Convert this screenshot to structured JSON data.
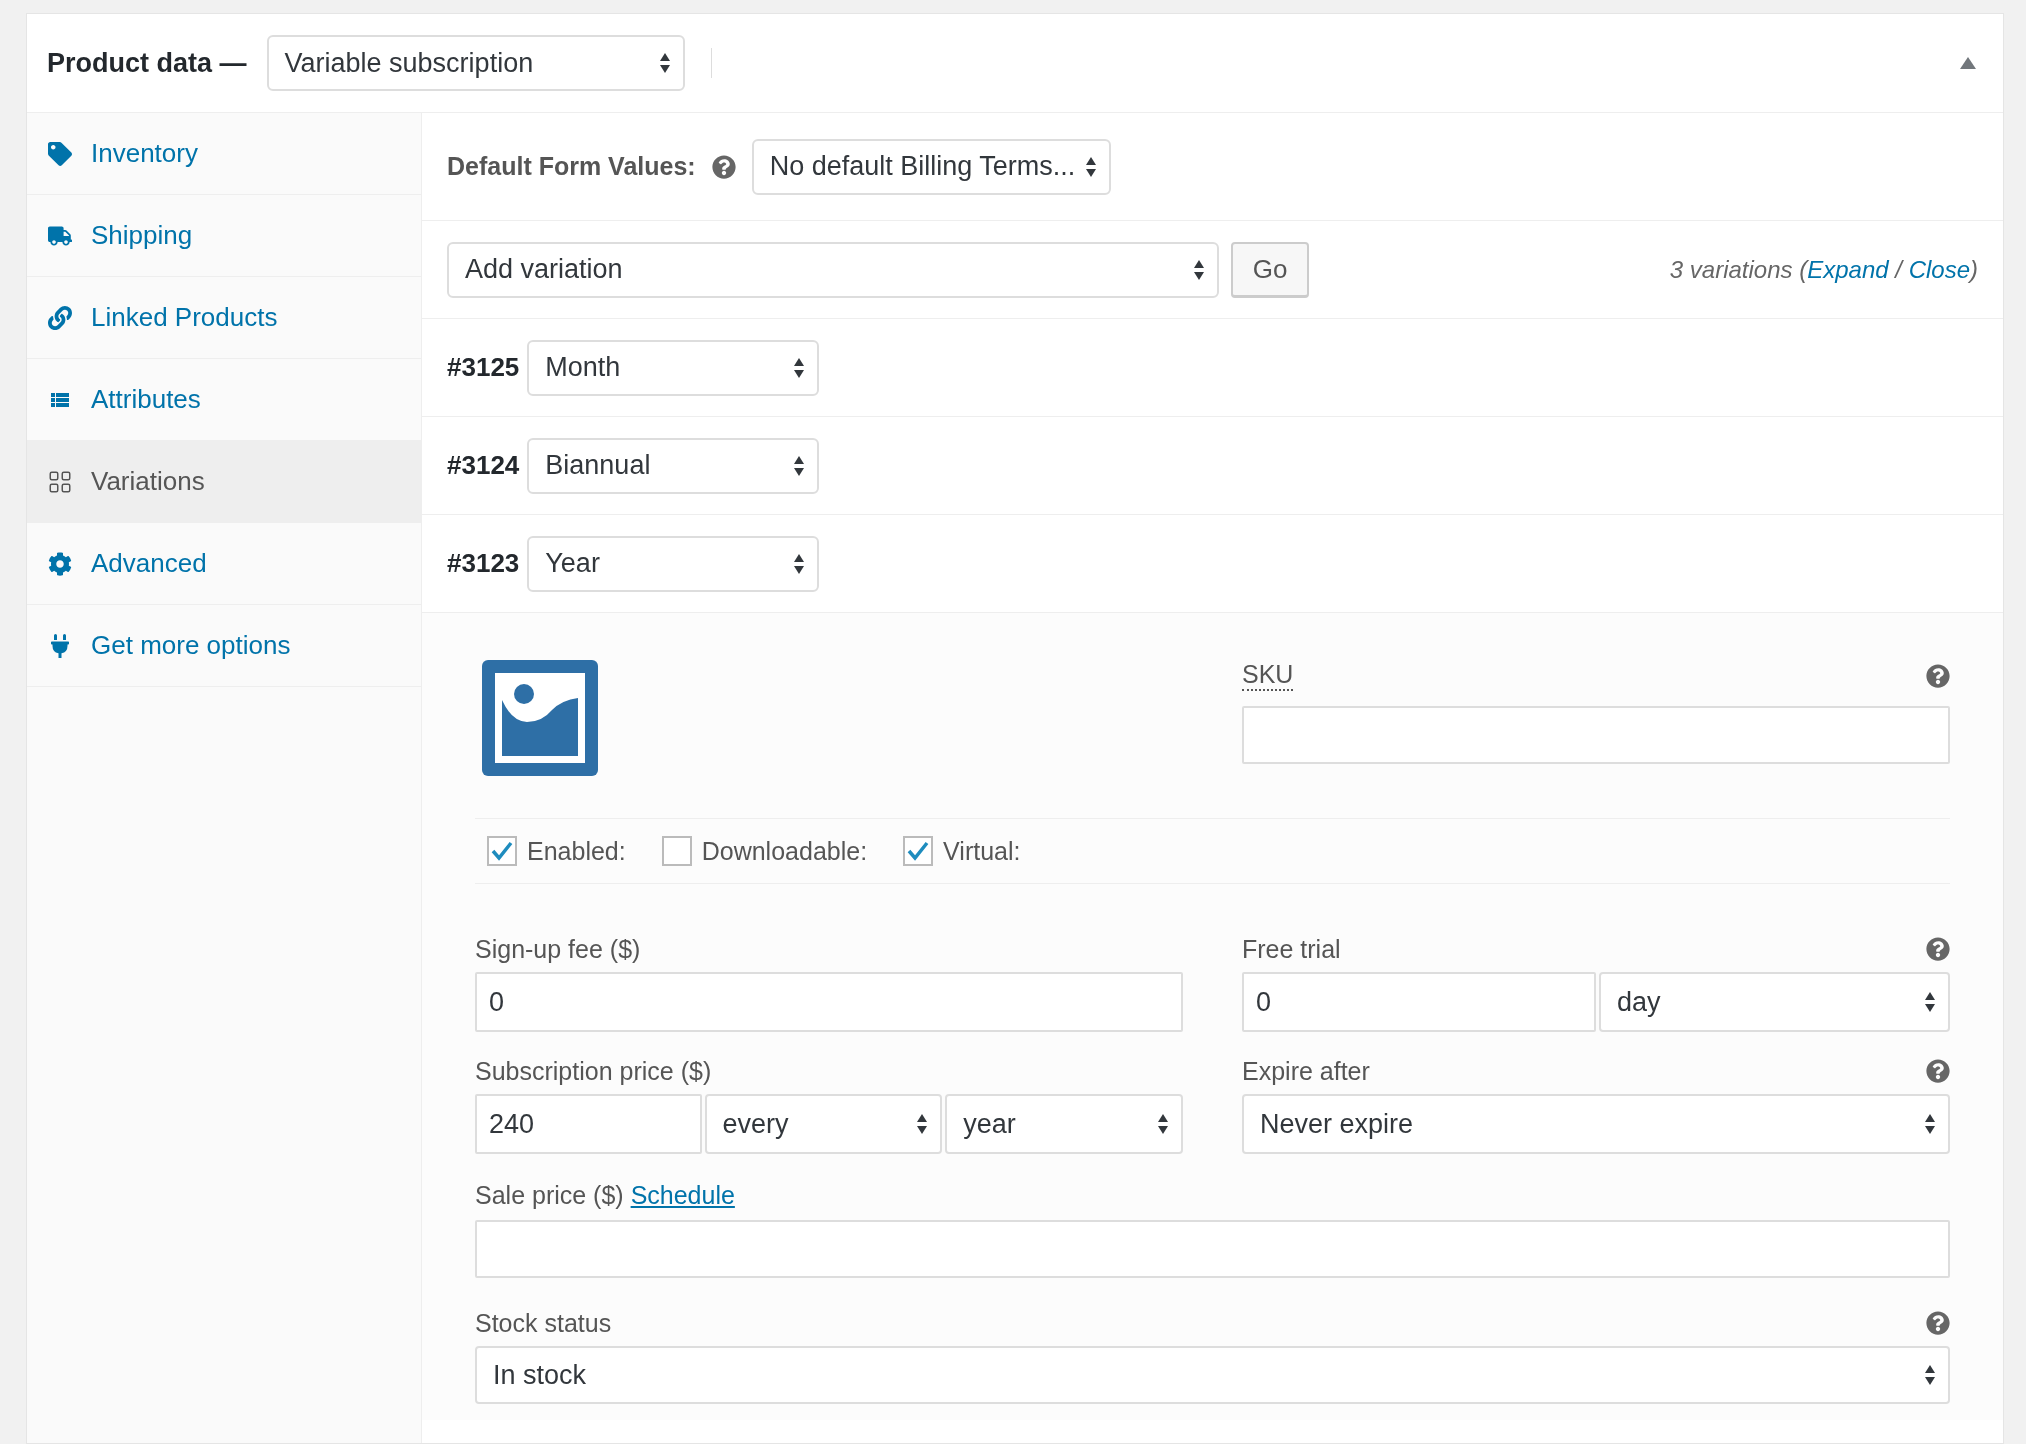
{
  "header": {
    "title": "Product data —",
    "product_type": "Variable subscription",
    "collapsed": false
  },
  "sidebar": {
    "items": [
      {
        "label": "Inventory",
        "selected": false
      },
      {
        "label": "Shipping",
        "selected": false
      },
      {
        "label": "Linked Products",
        "selected": false
      },
      {
        "label": "Attributes",
        "selected": false
      },
      {
        "label": "Variations",
        "selected": true
      },
      {
        "label": "Advanced",
        "selected": false
      },
      {
        "label": "Get more options",
        "selected": false
      }
    ]
  },
  "default_form_values": {
    "label": "Default Form Values:",
    "value": "No default Billing Terms..."
  },
  "toolbar": {
    "action": "Add variation",
    "button": "Go",
    "count_parts": [
      {
        "text": "3 variations (",
        "link": false
      },
      {
        "text": "Expand",
        "link": true
      },
      {
        "text": " / ",
        "link": false
      },
      {
        "text": "Close",
        "link": true
      },
      {
        "text": ")",
        "link": false
      }
    ]
  },
  "variations": [
    {
      "id": "#3125",
      "period": "Month"
    },
    {
      "id": "#3124",
      "period": "Biannual"
    },
    {
      "id": "#3123",
      "period": "Year"
    }
  ],
  "variation_details": {
    "sku": {
      "label": "SKU"
    },
    "checkboxes": [
      {
        "label": "Enabled:",
        "checked": true
      },
      {
        "label": "Downloadable:",
        "checked": false
      },
      {
        "label": "Virtual:",
        "checked": true
      }
    ],
    "signup_fee": {
      "label": "Sign-up fee ($)",
      "value": "0"
    },
    "free_trial": {
      "label": "Free trial",
      "value": "0",
      "unit": "day"
    },
    "subscription_price": {
      "label": "Subscription price ($)",
      "value": "240",
      "interval": "every",
      "period": "year"
    },
    "expire_after": {
      "label": "Expire after",
      "value": "Never expire"
    },
    "sale_price": {
      "label": "Sale price ($)",
      "link": "Schedule"
    },
    "stock_status": {
      "label": "Stock status",
      "value": "In stock"
    }
  }
}
